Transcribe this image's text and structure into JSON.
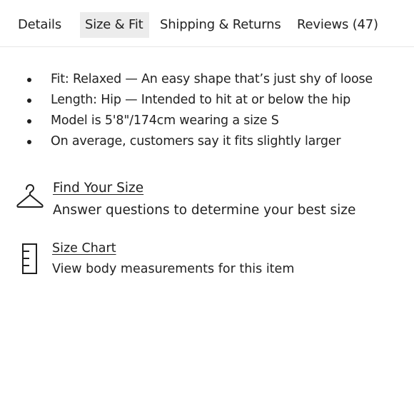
{
  "tabs": [
    {
      "label": "Details",
      "active": false
    },
    {
      "label": "Size & Fit",
      "active": true
    },
    {
      "label": "Shipping & Returns",
      "active": false
    },
    {
      "label": "Reviews (47)",
      "active": false
    }
  ],
  "fit_details": [
    "Fit: Relaxed — An easy shape that’s just shy of loose",
    "Length: Hip — Intended to hit at or below the hip",
    "Model is 5'8\"/174cm wearing a size S",
    "On average, customers say it fits slightly larger"
  ],
  "find_size": {
    "icon": "hanger-icon",
    "link": "Find Your Size",
    "description": "Answer questions to determine your best size"
  },
  "size_chart": {
    "icon": "ruler-icon",
    "link": "Size Chart",
    "description": "View body measurements for this item"
  },
  "colors": {
    "text": "#1f1f1f",
    "active_tab_bg": "#ececec",
    "divider": "#e6e6e6"
  }
}
